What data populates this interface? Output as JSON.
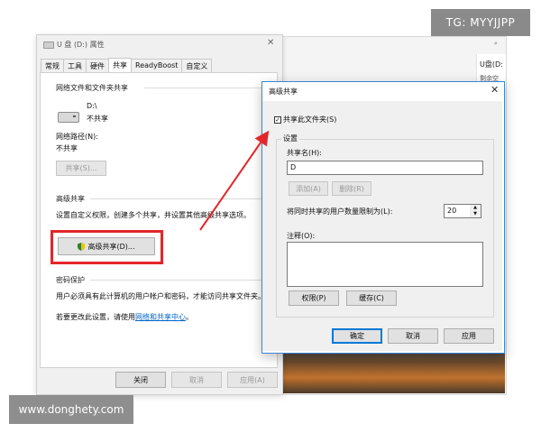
{
  "watermarks": {
    "tg": "TG: MYYJJPP",
    "site": "www.donghety.com"
  },
  "explorer_bg": {
    "search_icon": "⌕",
    "drive_label": "U盘(D:",
    "drive_sub": "剩余空"
  },
  "properties": {
    "title": "U 盘 (D:) 属性",
    "close": "✕",
    "tabs": [
      "常规",
      "工具",
      "硬件",
      "共享",
      "ReadyBoost",
      "自定义"
    ],
    "active_tab_index": 3,
    "network_group_title": "网络文件和文件夹共享",
    "drive_name": "D:\\",
    "drive_status": "不共享",
    "network_path_label": "网络路径(N):",
    "network_path_value": "不共享",
    "share_button": "共享(S)...",
    "advanced_group_title": "高级共享",
    "advanced_desc": "设置自定义权限，创建多个共享，并设置其他高级共享选项。",
    "advanced_button": "高级共享(D)...",
    "password_group_title": "密码保护",
    "password_desc": "用户必须具有此计算机的用户帐户和密码，才能访问共享文件夹。",
    "password_change_prefix": "若要更改此设置，请使用",
    "password_link": "网络和共享中心",
    "password_change_suffix": "。",
    "footer": {
      "ok": "关闭",
      "cancel": "取消",
      "apply": "应用(A)"
    }
  },
  "advanced_dialog": {
    "title": "高级共享",
    "close": "✕",
    "share_checkbox_label": "共享此文件夹(S)",
    "share_checked": true,
    "checkbox_mark": "✓",
    "settings_label": "设置",
    "share_name_label": "共享名(H):",
    "share_name_value": "D",
    "add_button": "添加(A)",
    "remove_button": "删除(R)",
    "limit_label": "将同时共享的用户数量限制为(L):",
    "limit_value": "20",
    "spinner_up": "▲",
    "spinner_down": "▼",
    "comment_label": "注释(O):",
    "permissions_button": "权限(P)",
    "cache_button": "缓存(C)",
    "ok_button": "确定",
    "cancel_button": "取消",
    "apply_button": "应用"
  },
  "colors": {
    "highlight_red": "#e3262a",
    "arrow_red": "#e3262a",
    "dialog_border": "#3a87d4",
    "link": "#0066cc"
  }
}
